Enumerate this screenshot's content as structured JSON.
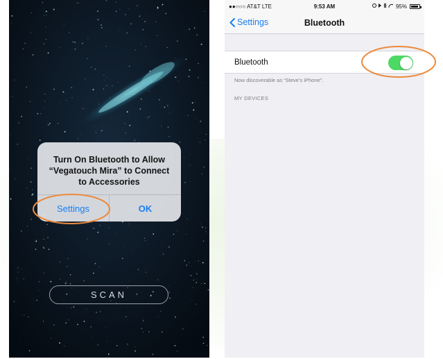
{
  "left_screen": {
    "alert": {
      "title": "Turn On Bluetooth to Allow\n“Vegatouch Mira” to Connect\nto Accessories",
      "settings_label": "Settings",
      "ok_label": "OK"
    },
    "scan_label": "SCAN"
  },
  "right_screen": {
    "status_bar": {
      "carrier": "●●○○○ AT&T  LTE",
      "time": "9:53 AM",
      "battery": "95%"
    },
    "nav": {
      "back_label": "Settings",
      "title": "Bluetooth"
    },
    "bluetooth_row": {
      "label": "Bluetooth",
      "enabled": true
    },
    "discoverable_text": "Now discoverable as “Steve’s iPhone”.",
    "section_header": "MY DEVICES"
  },
  "colors": {
    "ios_blue": "#1a7ef2",
    "toggle_on": "#4cd964",
    "annotation": "#ec8a3d"
  }
}
